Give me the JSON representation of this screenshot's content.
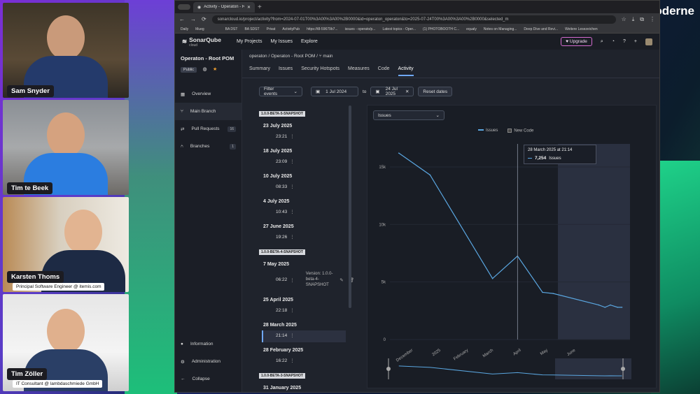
{
  "brand": {
    "name": "Moderne"
  },
  "participants": [
    {
      "name": "Sam Snyder",
      "role": ""
    },
    {
      "name": "Tim te Beek",
      "role": ""
    },
    {
      "name": "Karsten Thoms",
      "role": "Principal Software Engineer @ itemis.com"
    },
    {
      "name": "Tim Zöller",
      "role": "IT Consultant @ lambdaschmiede GmbH"
    }
  ],
  "browser": {
    "tab_title": "Activity - Operaton - Root POM",
    "url": "sonarcloud.io/project/activity?from=2024-07-01T00%3A00%3A00%2B0000&id=operaton_operaton&to=2025-07-24T00%3A00%3A00%2B0000&selected_m",
    "bookmarks": [
      "Daily",
      "Mueg",
      "",
      "",
      "BA DST",
      "BA SDST",
      "Privat",
      "ActivityPub",
      "https://t8-59679b7...",
      "issues - operato/p...",
      "Latest topics - Oper...",
      "(1) PHOTOBOOTH C...",
      "equaly",
      "Notes on Managing...",
      "Deep Dive and Revi...",
      "Weitere Lesezeichen"
    ]
  },
  "app": {
    "logo": "SonarQube",
    "logo_sub": "cloud",
    "nav": [
      "My Projects",
      "My Issues",
      "Explore"
    ],
    "upgrade_label": "Upgrade"
  },
  "project": {
    "title": "Operaton - Root POM",
    "visibility": "Public",
    "breadcrumb": "operaton  /  Operaton - Root POM  /  ⑂ main"
  },
  "sidenav": {
    "items": [
      {
        "label": "Overview",
        "count": ""
      },
      {
        "label": "Main Branch",
        "count": ""
      },
      {
        "label": "Pull Requests",
        "count": "16"
      },
      {
        "label": "Branches",
        "count": "1"
      }
    ],
    "bottom": [
      "Information",
      "Administration",
      "Collapse"
    ]
  },
  "subtabs": [
    "Summary",
    "Issues",
    "Security Hotspots",
    "Measures",
    "Code",
    "Activity"
  ],
  "filters": {
    "events_placeholder": "Filter events",
    "from": "1 Jul 2024",
    "to_label": "to",
    "to": "24 Jul 2025",
    "reset": "Reset dates"
  },
  "timeline": [
    {
      "snapshot": "1.0.0-BETA-5-SNAPSHOT"
    },
    {
      "date": "23 July 2025",
      "time": "23:21"
    },
    {
      "date": "18 July 2025",
      "time": "23:09"
    },
    {
      "date": "10 July 2025",
      "time": "08:33"
    },
    {
      "date": "4 July 2025",
      "time": "10:43"
    },
    {
      "date": "27 June 2025",
      "time": "19:26"
    },
    {
      "snapshot": "1.0.0-BETA-4-SNAPSHOT"
    },
    {
      "date": "7 May 2025",
      "time": "06:22",
      "version": "Version: 1.0.0-beta-4-SNAPSHOT"
    },
    {
      "date": "25 April 2025",
      "time": "22:18"
    },
    {
      "date": "28 March 2025",
      "time": "21:14",
      "selected": true
    },
    {
      "date": "28 February 2025",
      "time": "16:22"
    },
    {
      "snapshot": "1.0.0-BETA-3-SNAPSHOT"
    },
    {
      "date": "31 January 2025",
      "time": ""
    }
  ],
  "chart_select": "Issues",
  "tooltip": {
    "title": "28 March 2025 at 21:14",
    "value": "7,254",
    "metric": "Issues"
  },
  "colors": {
    "series": "#5aa6e0",
    "accent": "#6fa8ff",
    "upgrade": "#d56bd0"
  },
  "chart_data": {
    "type": "line",
    "legend": [
      "Issues",
      "New Code"
    ],
    "x_ticks": [
      "December",
      "2025",
      "February",
      "March",
      "April",
      "May",
      "June"
    ],
    "y_ticks": [
      "0",
      "5k",
      "10k",
      "15k"
    ],
    "ylim": [
      0,
      17000
    ],
    "series": [
      {
        "name": "Issues",
        "x": [
          "2024-11-15",
          "2024-12-20",
          "2025-02-28",
          "2025-03-28",
          "2025-04-25",
          "2025-05-07",
          "2025-06-27",
          "2025-07-04",
          "2025-07-10",
          "2025-07-18",
          "2025-07-23"
        ],
        "values": [
          16200,
          14300,
          5300,
          7254,
          4100,
          4000,
          3000,
          2800,
          3000,
          2800,
          2800
        ]
      }
    ]
  }
}
